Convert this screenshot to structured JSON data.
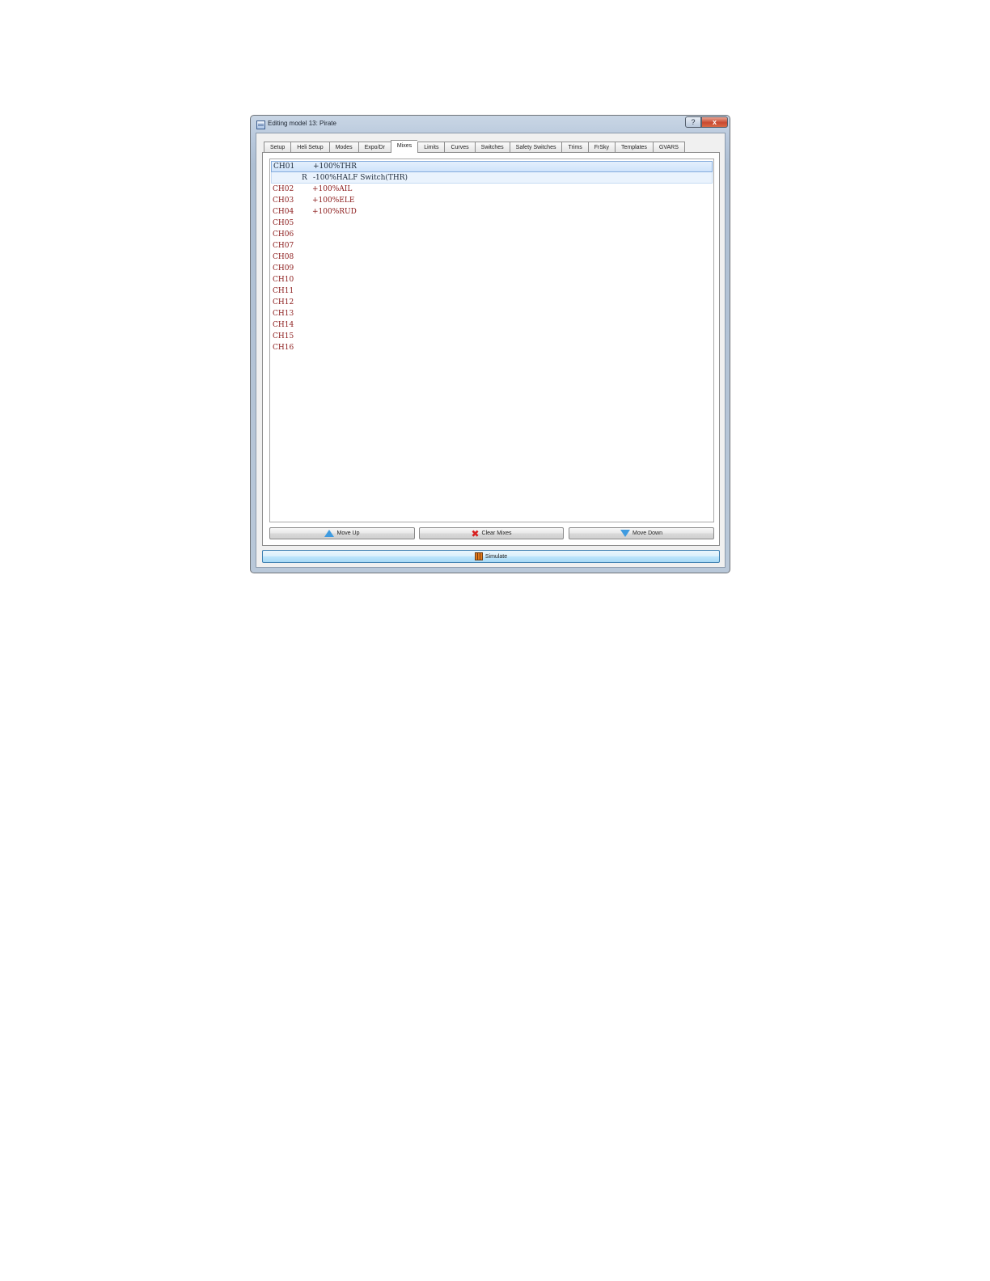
{
  "window": {
    "title": "Editing model 13: Pirate",
    "help_label": "?",
    "close_label": "x"
  },
  "tabs": [
    "Setup",
    "Heli Setup",
    "Modes",
    "Expo/Dr",
    "Mixes",
    "Limits",
    "Curves",
    "Switches",
    "Safety Switches",
    "Trims",
    "FrSky",
    "Templates",
    "GVARS"
  ],
  "active_tab": "Mixes",
  "mixes": [
    {
      "channel": "CH01",
      "flag": "",
      "desc": "+100%THR"
    },
    {
      "channel": "",
      "flag": "R",
      "desc": "-100%HALF Switch(THR)"
    },
    {
      "channel": "CH02",
      "flag": "",
      "desc": "+100%AIL"
    },
    {
      "channel": "CH03",
      "flag": "",
      "desc": "+100%ELE"
    },
    {
      "channel": "CH04",
      "flag": "",
      "desc": "+100%RUD"
    },
    {
      "channel": "CH05",
      "flag": "",
      "desc": ""
    },
    {
      "channel": "CH06",
      "flag": "",
      "desc": ""
    },
    {
      "channel": "CH07",
      "flag": "",
      "desc": ""
    },
    {
      "channel": "CH08",
      "flag": "",
      "desc": ""
    },
    {
      "channel": "CH09",
      "flag": "",
      "desc": ""
    },
    {
      "channel": "CH10",
      "flag": "",
      "desc": ""
    },
    {
      "channel": "CH11",
      "flag": "",
      "desc": ""
    },
    {
      "channel": "CH12",
      "flag": "",
      "desc": ""
    },
    {
      "channel": "CH13",
      "flag": "",
      "desc": ""
    },
    {
      "channel": "CH14",
      "flag": "",
      "desc": ""
    },
    {
      "channel": "CH15",
      "flag": "",
      "desc": ""
    },
    {
      "channel": "CH16",
      "flag": "",
      "desc": ""
    }
  ],
  "buttons": {
    "move_up": "Move Up",
    "clear_mixes": "Clear Mixes",
    "move_down": "Move Down",
    "simulate": "Simulate"
  },
  "icons": {
    "move_up": "up-arrow-icon",
    "clear_mixes": "red-x-icon",
    "move_down": "down-arrow-icon",
    "simulate": "simulator-icon"
  },
  "colors": {
    "channel_text": "#8b1a1a",
    "selection": "#cfe3fb",
    "close_button": "#c94a31",
    "simulate_button": "#bee6fd"
  }
}
